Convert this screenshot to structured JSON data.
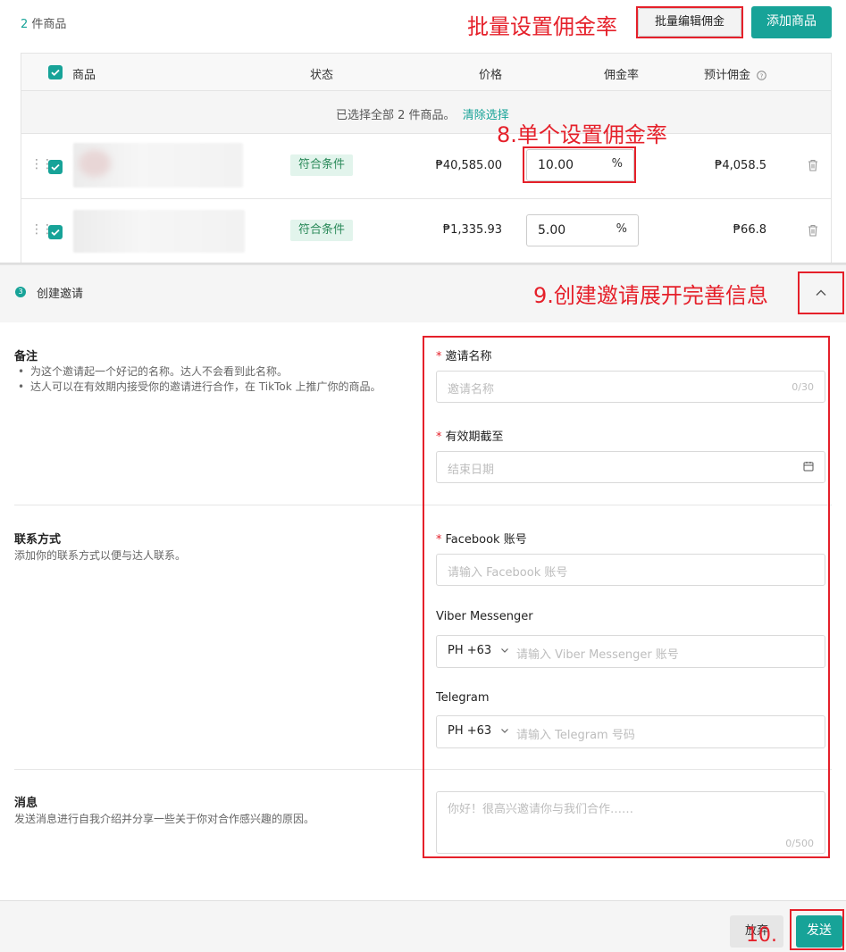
{
  "header": {
    "count_num": "2",
    "count_label": "件商品",
    "batch_annotation": "批量设置佣金率",
    "batch_edit_button": "批量编辑佣金",
    "add_product_button": "添加商品"
  },
  "table": {
    "columns": {
      "product": "商品",
      "status": "状态",
      "price": "价格",
      "commission_rate": "佣金率",
      "est_commission": "预计佣金"
    },
    "selection_text": "已选择全部 2 件商品。",
    "clear_selection": "清除选择",
    "single_annotation": "8.单个设置佣金率",
    "rows": [
      {
        "status": "符合条件",
        "price": "₱40,585.00",
        "rate": "10.00",
        "percent": "%",
        "est": "₱4,058.5"
      },
      {
        "status": "符合条件",
        "price": "₱1,335.93",
        "rate": "5.00",
        "percent": "%",
        "est": "₱66.8"
      }
    ]
  },
  "invite_section": {
    "step_number": "3",
    "title": "创建邀请",
    "expand_annotation": "9.创建邀请展开完善信息"
  },
  "remarks": {
    "title": "备注",
    "bullets": [
      "为这个邀请起一个好记的名称。达人不会看到此名称。",
      "达人可以在有效期内接受你的邀请进行合作，在 TikTok 上推广你的商品。"
    ],
    "name_label": "邀请名称",
    "name_placeholder": "邀请名称",
    "name_counter": "0/30",
    "expiry_label": "有效期截至",
    "expiry_placeholder": "结束日期"
  },
  "contact": {
    "title": "联系方式",
    "desc": "添加你的联系方式以便与达人联系。",
    "facebook_label": "Facebook 账号",
    "facebook_placeholder": "请输入 Facebook 账号",
    "viber_label": "Viber Messenger",
    "viber_code": "PH +63",
    "viber_placeholder": "请输入 Viber Messenger 账号",
    "telegram_label": "Telegram",
    "telegram_code": "PH +63",
    "telegram_placeholder": "请输入 Telegram 号码"
  },
  "message": {
    "title": "消息",
    "desc": "发送消息进行自我介绍并分享一些关于你对合作感兴趣的原因。",
    "placeholder": "你好！很高兴邀请你与我们合作……",
    "counter": "0/500"
  },
  "footer": {
    "cancel_button": "放弃",
    "send_button": "发送",
    "send_annotation": "10."
  },
  "colors": {
    "accent": "#17a398",
    "annotation_red": "#e5202a",
    "tag_bg": "#e2f4ec"
  }
}
